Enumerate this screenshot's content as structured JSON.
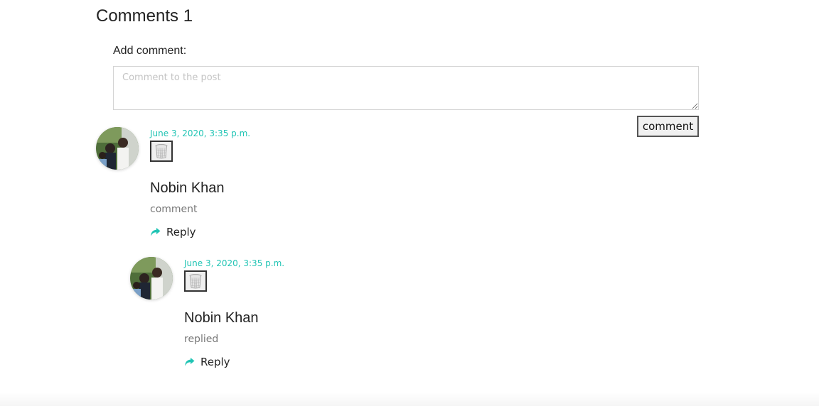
{
  "section": {
    "title": "Comments 1"
  },
  "form": {
    "label": "Add comment:",
    "placeholder": "Comment to the post",
    "submit_label": "comment"
  },
  "comments": [
    {
      "date": "June 3, 2020, 3:35 p.m.",
      "author": "Nobin Khan",
      "text": "comment",
      "reply_label": "Reply"
    },
    {
      "date": "June 3, 2020, 3:35 p.m.",
      "author": "Nobin Khan",
      "text": "replied",
      "reply_label": "Reply"
    }
  ],
  "colors": {
    "accent": "#20c4b4",
    "muted_text": "#777777"
  },
  "icons": {
    "delete": "trash-icon",
    "reply": "reply-arrow-icon"
  }
}
